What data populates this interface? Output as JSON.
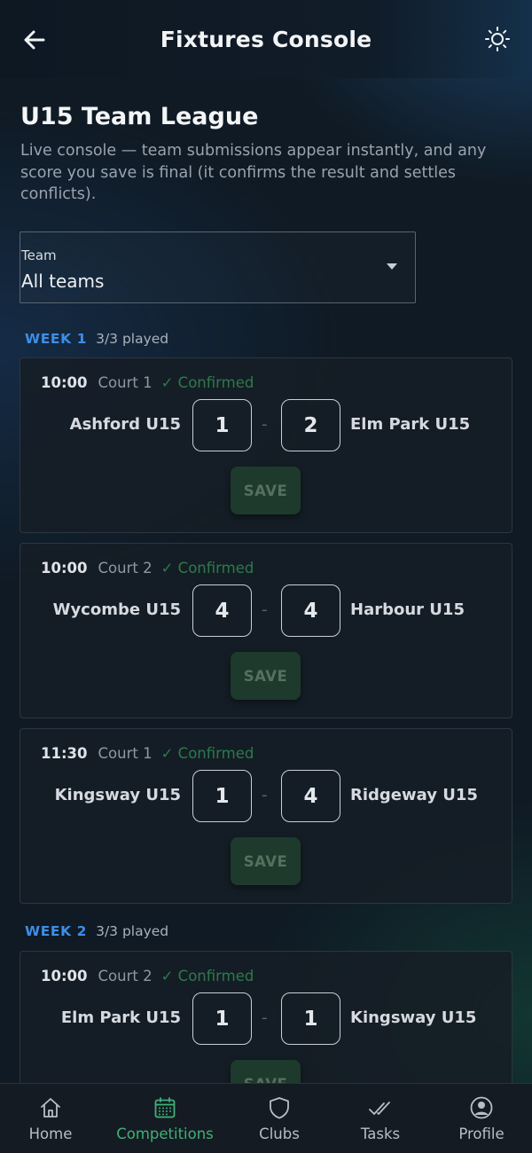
{
  "header": {
    "title": "Fixtures Console",
    "back_icon": "arrow-left-icon",
    "theme_icon": "sun-icon"
  },
  "league": {
    "title": "U15 Team League",
    "description": "Live console — team submissions appear instantly, and any score you save is final (it confirms the result and settles conflicts)."
  },
  "team_filter": {
    "label": "Team",
    "value": "All teams"
  },
  "weeks": [
    {
      "label": "WEEK 1",
      "played": "3/3 played",
      "matches": [
        {
          "time": "10:00",
          "court": "Court 1",
          "status": "✓ Confirmed",
          "home": "Ashford U15",
          "home_score": "1",
          "away_score": "2",
          "away": "Elm Park U15",
          "save": "SAVE"
        },
        {
          "time": "10:00",
          "court": "Court 2",
          "status": "✓ Confirmed",
          "home": "Wycombe U15",
          "home_score": "4",
          "away_score": "4",
          "away": "Harbour U15",
          "save": "SAVE"
        },
        {
          "time": "11:30",
          "court": "Court 1",
          "status": "✓ Confirmed",
          "home": "Kingsway U15",
          "home_score": "1",
          "away_score": "4",
          "away": "Ridgeway U15",
          "save": "SAVE"
        }
      ]
    },
    {
      "label": "WEEK 2",
      "played": "3/3 played",
      "matches": [
        {
          "time": "10:00",
          "court": "Court 2",
          "status": "✓ Confirmed",
          "home": "Elm Park U15",
          "home_score": "1",
          "away_score": "1",
          "away": "Kingsway U15",
          "save": "SAVE"
        }
      ]
    }
  ],
  "score_separator": "-",
  "bottom_nav": [
    {
      "label": "Home",
      "icon": "home-icon",
      "active": false
    },
    {
      "label": "Competitions",
      "icon": "calendar-icon",
      "active": true
    },
    {
      "label": "Clubs",
      "icon": "shield-icon",
      "active": false
    },
    {
      "label": "Tasks",
      "icon": "double-check-icon",
      "active": false
    },
    {
      "label": "Profile",
      "icon": "user-circle-icon",
      "active": false
    }
  ],
  "colors": {
    "accent_green": "#3fb179",
    "week_blue": "#3d8ee6",
    "confirmed_green": "#2d7a4a"
  }
}
